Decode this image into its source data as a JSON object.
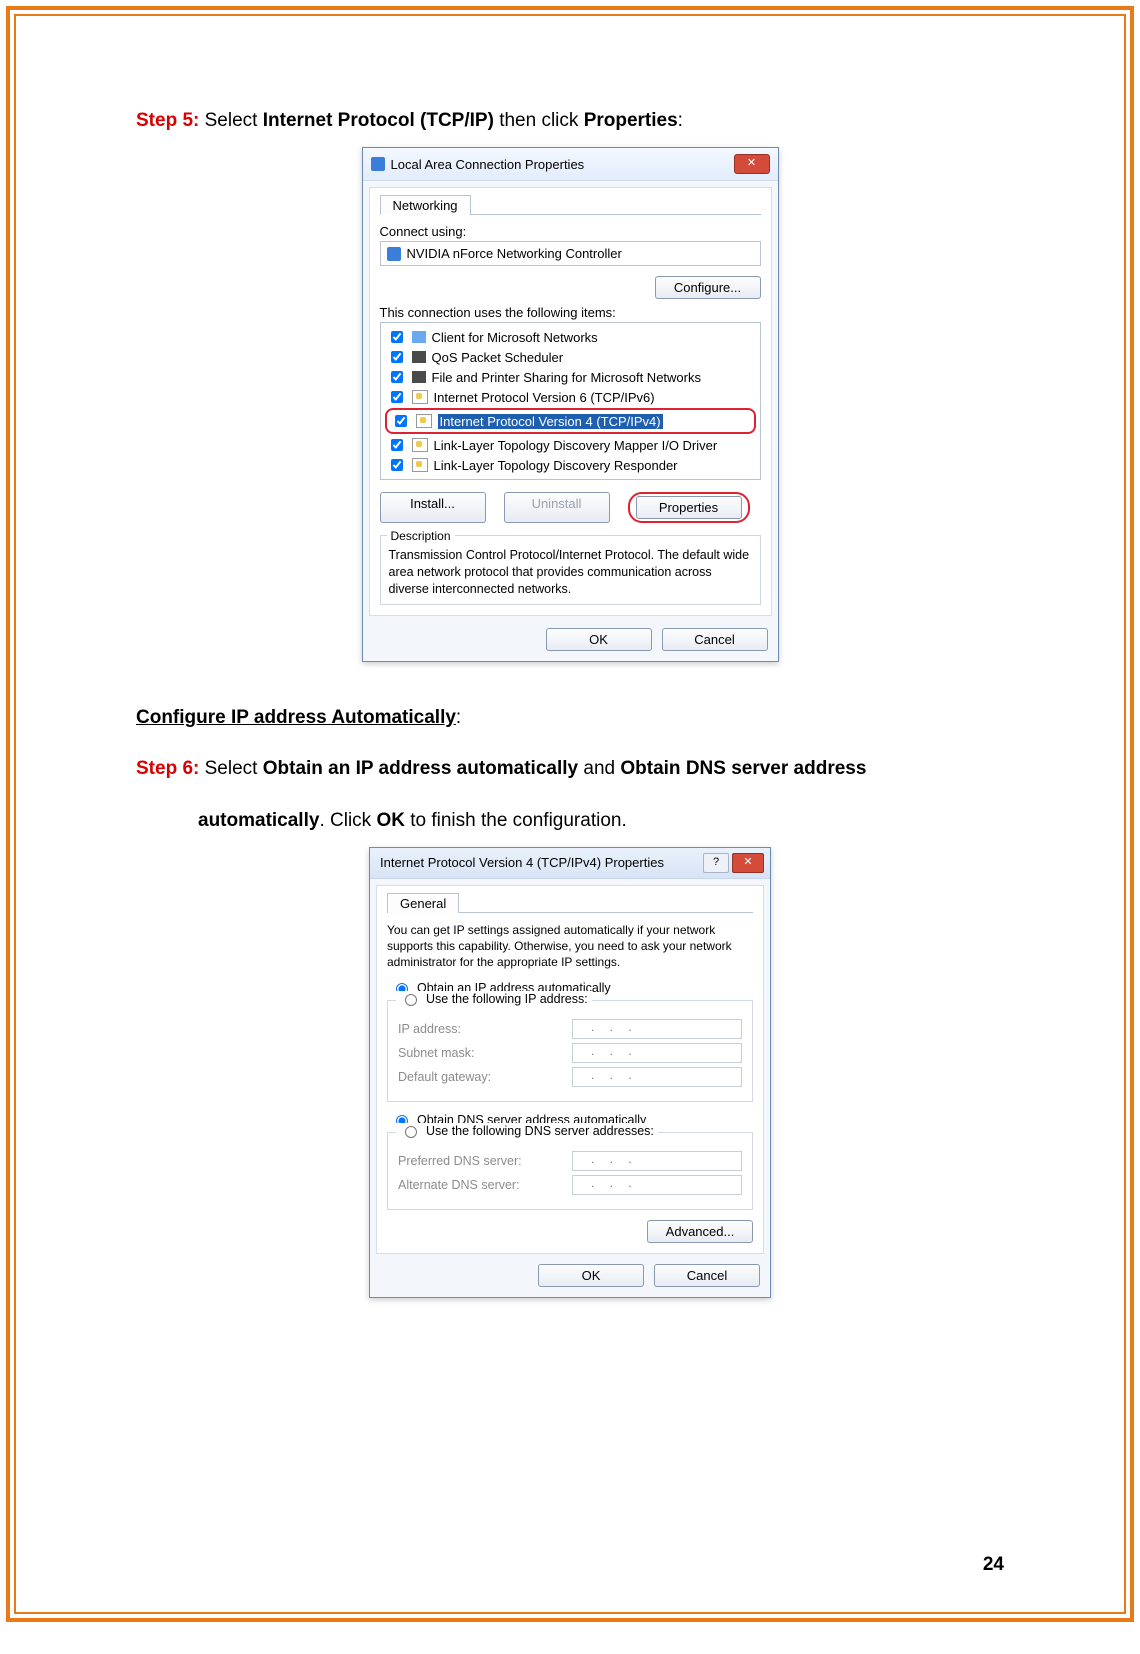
{
  "steps": {
    "s5_label": "Step 5:",
    "s5_a": " Select ",
    "s5_b": "Internet Protocol (TCP/IP)",
    "s5_c": " then click ",
    "s5_d": "Properties",
    "s5_e": ":",
    "cfg_auto": "Configure IP address Automatically",
    "s6_label": "Step 6:",
    "s6_a": " Select ",
    "s6_b": "Obtain an IP address automatically",
    "s6_c": " and ",
    "s6_d": "Obtain DNS server address",
    "s6_e": "automatically",
    "s6_f": ". Click ",
    "s6_g": "OK",
    "s6_h": " to finish the configuration."
  },
  "dlg1": {
    "title": "Local Area Connection Properties",
    "close": "✕",
    "tab": "Networking",
    "connect_using": "Connect using:",
    "adapter": "NVIDIA nForce Networking Controller",
    "configure": "Configure...",
    "uses_items": "This connection uses the following items:",
    "items": {
      "i0": "Client for Microsoft Networks",
      "i1": "QoS Packet Scheduler",
      "i2": "File and Printer Sharing for Microsoft Networks",
      "i3": "Internet Protocol Version 6 (TCP/IPv6)",
      "i4": "Internet Protocol Version 4 (TCP/IPv4)",
      "i5": "Link-Layer Topology Discovery Mapper I/O Driver",
      "i6": "Link-Layer Topology Discovery Responder"
    },
    "install": "Install...",
    "uninstall": "Uninstall",
    "properties": "Properties",
    "desc_title": "Description",
    "desc_body": "Transmission Control Protocol/Internet Protocol. The default wide area network protocol that provides communication across diverse interconnected networks.",
    "ok": "OK",
    "cancel": "Cancel"
  },
  "dlg2": {
    "title": "Internet Protocol Version 4 (TCP/IPv4) Properties",
    "help": "?",
    "close": "✕",
    "tab": "General",
    "intro": "You can get IP settings assigned automatically if your network supports this capability. Otherwise, you need to ask your network administrator for the appropriate IP settings.",
    "r_ip_auto": "Obtain an IP address automatically",
    "r_ip_man": "Use the following IP address:",
    "ip_label": "IP address:",
    "sm_label": "Subnet mask:",
    "gw_label": "Default gateway:",
    "r_dns_auto": "Obtain DNS server address automatically",
    "r_dns_man": "Use the following DNS server addresses:",
    "pdns": "Preferred DNS server:",
    "adns": "Alternate DNS server:",
    "dots": ".   .   .",
    "advanced": "Advanced...",
    "ok": "OK",
    "cancel": "Cancel"
  },
  "page_number": "24"
}
